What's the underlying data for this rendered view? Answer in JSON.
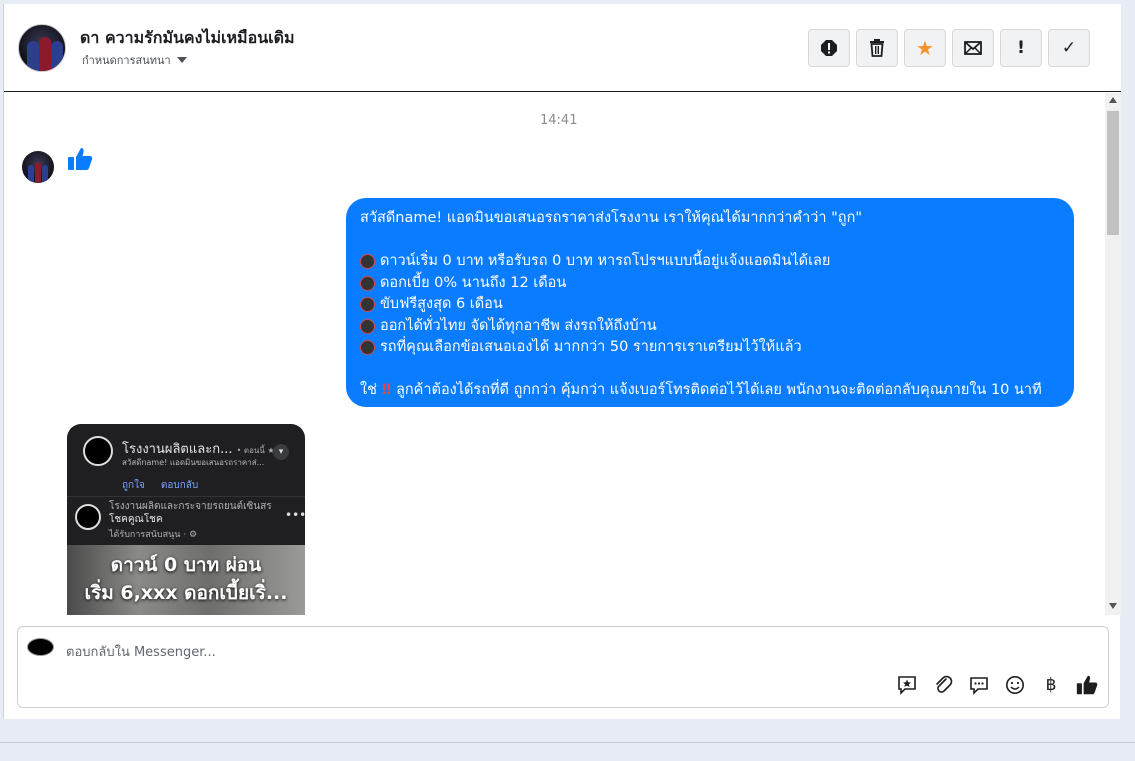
{
  "header": {
    "title": "ดา ความรักมันคงไม่เหมือนเดิม",
    "subtitle": "กำหนดการสนทนา",
    "toolbar": [
      {
        "name": "report-icon",
        "glyph": "!"
      },
      {
        "name": "trash-icon",
        "glyph": ""
      },
      {
        "name": "star-icon",
        "glyph": "★"
      },
      {
        "name": "mail-icon",
        "glyph": "✉"
      },
      {
        "name": "exclamation-icon",
        "glyph": "!"
      },
      {
        "name": "check-icon",
        "glyph": "✓"
      }
    ],
    "star_color": "#f5922a"
  },
  "conversation": {
    "timestamp": "14:41",
    "like_color": "#0a7cff",
    "bubble": {
      "color": "#0a7cff",
      "greeting": "สวัสดีname! แอดมินขอเสนอรถราคาส่งโรงงาน เราให้คุณได้มากกว่าคำว่า \"ถูก\"",
      "items": [
        "ดาวน์เริ่ม 0 บาท หรือรับรถ 0 บาท หารถโปรฯแบบนี้อยู่แจ้งแอดมินได้เลย",
        "ดอกเบี้ย 0% นานถึง 12 เดือน",
        "ขับฟรีสูงสุด 6 เดือน",
        "ออกได้ทั่วไทย จัดได้ทุกอาชีพ ส่งรถให้ถึงบ้าน",
        "รถที่คุณเลือกข้อเสนอเองได้ มากกว่า 50 รายการเราเตรียมไว้ให้แล้ว"
      ],
      "closing_prefix": "ใช่",
      "closing_mark": "‼",
      "closing_text": "ลูกค้าต้องได้รถที่ดี ถูกกว่า คุ้มกว่า แจ้งเบอร์โทรติดต่อไว้ได้เลย พนักงานจะติดต่อกลับคุณภายใน 10 นาที"
    },
    "card": {
      "page_name": "โรงงานผลิตและก...",
      "page_meta": "• ตอนนี้ ★",
      "preview": "สวัสดีname! แอดมินขอเสนอรถราคาส่...",
      "like_action": "ถูกใจ",
      "reply_action": "ตอบกลับ",
      "post_name_1": "โรงงานผลิตและกระจายรถยนต์เซินสร",
      "post_name_2": "โชคคูณโชค",
      "sponsored": "ได้รับการสนับสนุน · ⚙",
      "banner_line1": "ดาวน์ 0 บาท ผ่อน",
      "banner_line2": "เริ่ม 6,xxx ดอกเบี้ยเริ่..."
    }
  },
  "composer": {
    "placeholder": "ตอบกลับใน Messenger...",
    "icons": [
      "sticker-icon",
      "attach-icon",
      "saved-reply-icon",
      "emoji-icon",
      "baht-icon",
      "like-icon"
    ],
    "baht_glyph": "฿"
  }
}
